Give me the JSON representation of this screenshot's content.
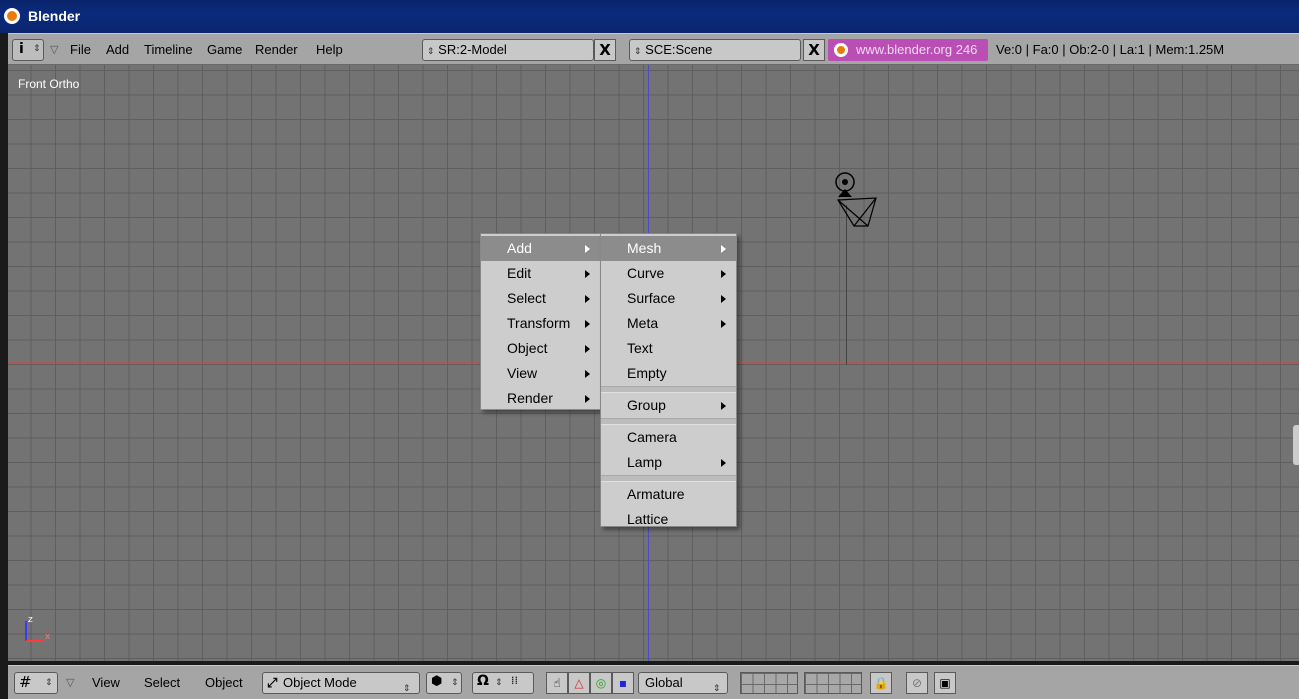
{
  "window": {
    "title": "Blender"
  },
  "top_header": {
    "menus": [
      "File",
      "Add",
      "Timeline",
      "Game",
      "Render",
      "Help"
    ],
    "screen_field": "SR:2-Model",
    "scene_field": "SCE:Scene",
    "close_glyph": "X",
    "url": "www.blender.org 246",
    "stats": "Ve:0 | Fa:0 | Ob:2-0 | La:1  | Mem:1.25M"
  },
  "viewport": {
    "view_label": "Front Ortho",
    "axis_z": "z",
    "axis_x": "x"
  },
  "main_menu": {
    "items": [
      {
        "label": "Add",
        "submenu": true,
        "active": true
      },
      {
        "label": "Edit",
        "submenu": true
      },
      {
        "label": "Select",
        "submenu": true
      },
      {
        "label": "Transform",
        "submenu": true
      },
      {
        "label": "Object",
        "submenu": true
      },
      {
        "label": "View",
        "submenu": true
      },
      {
        "label": "Render",
        "submenu": true
      }
    ]
  },
  "add_submenu": {
    "items": [
      {
        "label": "Mesh",
        "submenu": true,
        "active": true
      },
      {
        "label": "Curve",
        "submenu": true
      },
      {
        "label": "Surface",
        "submenu": true
      },
      {
        "label": "Meta",
        "submenu": true
      },
      {
        "label": "Text"
      },
      {
        "label": "Empty"
      },
      {
        "separator": true
      },
      {
        "label": "Group",
        "submenu": true
      },
      {
        "separator": true
      },
      {
        "label": "Camera"
      },
      {
        "label": "Lamp",
        "submenu": true
      },
      {
        "separator": true
      },
      {
        "label": "Armature"
      },
      {
        "label": "Lattice"
      }
    ]
  },
  "bottom_header": {
    "menus": [
      "View",
      "Select",
      "Object"
    ],
    "mode": "Object Mode",
    "orientation": "Global"
  },
  "colors": {
    "header": "#a5a5a5",
    "viewport": "#737373",
    "menu_bg": "#cdcdcd",
    "menu_active": "#8c8c8c",
    "url_bg": "#b94fb5"
  }
}
